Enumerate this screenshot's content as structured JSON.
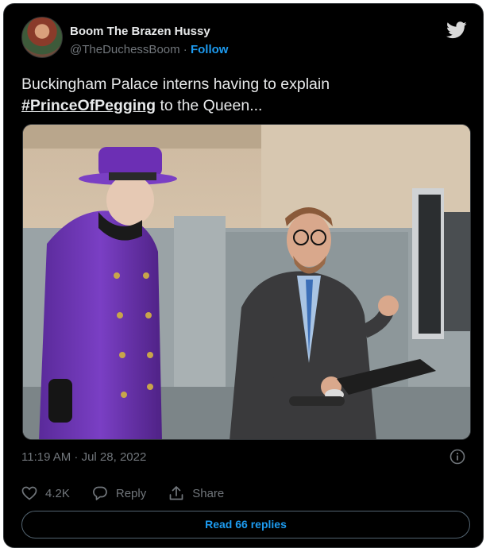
{
  "author": {
    "name": "Boom The Brazen Hussy",
    "handle": "@TheDuchessBoom",
    "separator": " · ",
    "follow_label": "Follow"
  },
  "tweet": {
    "text_before": "Buckingham Palace interns having to explain",
    "hashtag": "#PrinceOfPegging",
    "text_after": " to the Queen..."
  },
  "timestamp": "11:19 AM · Jul 28, 2022",
  "actions": {
    "like_count": "4.2K",
    "reply_label": "Reply",
    "share_label": "Share"
  },
  "read_replies_label": "Read 66 replies",
  "colors": {
    "background": "#000000",
    "accent": "#1d9bf0",
    "text": "#e7e9ea",
    "muted": "#71767b"
  },
  "icons": [
    "twitter-bird-icon",
    "info-icon",
    "heart-icon",
    "reply-bubble-icon",
    "share-icon"
  ]
}
